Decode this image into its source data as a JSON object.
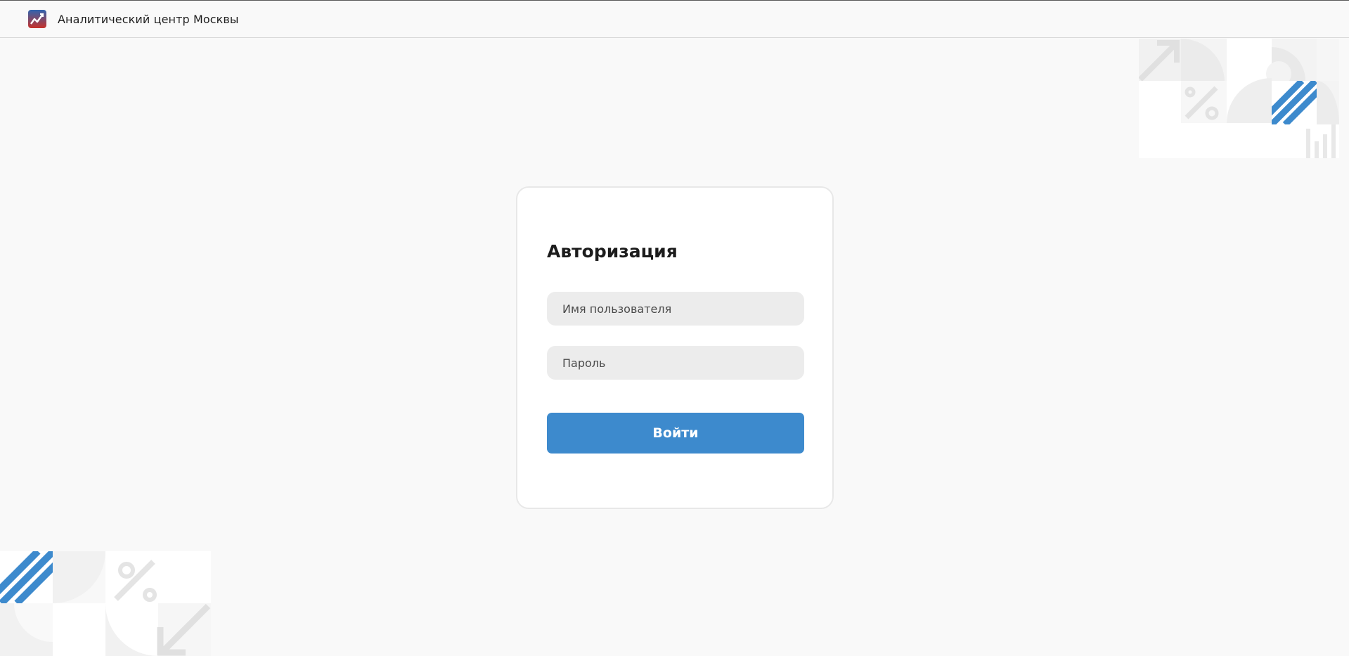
{
  "header": {
    "brand": "Аналитический центр Москвы",
    "logo_icon": "trend-chart-logo-icon"
  },
  "login": {
    "title": "Авторизация",
    "username_placeholder": "Имя пользователя",
    "username_value": "",
    "password_placeholder": "Пароль",
    "password_value": "",
    "submit_label": "Войти"
  },
  "colors": {
    "accent": "#3d8acd",
    "background": "#f9f9f9",
    "card": "#ffffff",
    "field": "#ececec",
    "decor_gray": "#e6e6e6"
  },
  "decorations": {
    "top_right_icons": [
      "arrow-up-right-icon",
      "percent-icon",
      "stripes-icon",
      "bar-chart-icon"
    ],
    "bottom_left_icons": [
      "stripes-icon",
      "percent-icon",
      "arrow-down-left-icon"
    ]
  }
}
